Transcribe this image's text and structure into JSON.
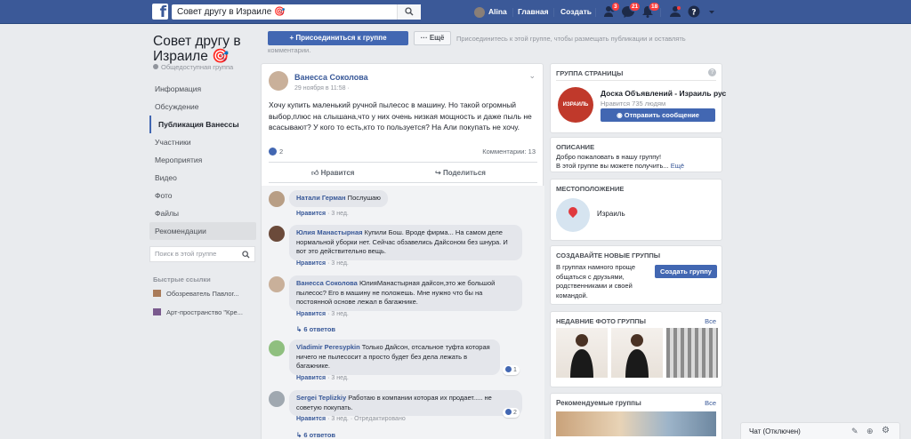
{
  "topbar": {
    "logo": "f",
    "search_value": "Совет другу в Израиле 🎯",
    "user_name": "Alina",
    "home": "Главная",
    "create": "Создать",
    "badges": {
      "friends": "3",
      "messages": "21",
      "notifications": "18"
    }
  },
  "group": {
    "title": "Совет другу в Израиле 🎯",
    "privacy": "Общедоступная группа",
    "nav": [
      {
        "label": "Информация"
      },
      {
        "label": "Обсуждение"
      },
      {
        "label": "Публикация Ванессы"
      },
      {
        "label": "Участники"
      },
      {
        "label": "Мероприятия"
      },
      {
        "label": "Видео"
      },
      {
        "label": "Фото"
      },
      {
        "label": "Файлы"
      },
      {
        "label": "Рекомендации"
      }
    ],
    "search_placeholder": "Поиск в этой группе",
    "quick_links_title": "Быстрые ссылки",
    "quick_links": [
      "Обозреватель Павлог...",
      "Арт-пространство \"Кре..."
    ]
  },
  "join": {
    "join_label": "Присоединиться к группе",
    "more_label": "Ещё",
    "note_line1": "Присоединитесь к этой группе, чтобы размещать публикации и оставлять",
    "note_line2": "комментарии."
  },
  "post": {
    "author": "Ванесса Соколова",
    "date": "29 ноября в 11:58",
    "text": "Хочу купить маленький ручной пылесос в машину. Но такой огромный выбор,плюс на слышана,что у них очень низкая мощность и даже пыль не всасывают? У кого то есть,кто то пользуется? На Али покупать не хочу.",
    "likes": "2",
    "comments_count": "Комментарии: 13",
    "like_action": "Нравится",
    "share_action": "Поделиться"
  },
  "comments": [
    {
      "author": "Натали Герман",
      "text": "Послушаю",
      "like": "Нравится",
      "time": "3 нед."
    },
    {
      "author": "Юлия Манастырная",
      "text": "Купили Бош. Вроде фирма... На самом деле нормальной уборки нет. Сейчас обзавелись Дайсоном без шнура. И вот это действительно вещь.",
      "like": "Нравится",
      "time": "3 нед."
    },
    {
      "author": "Ванесса Соколова",
      "text": "ЮлияМанастырная дайсон,это же большой пылесос? Его в машину не положешь. Мне нужно что бы на постоянной основе лежал в багажнике.",
      "like": "Нравится",
      "time": "3 нед.",
      "replies": "6 ответов"
    },
    {
      "author": "Vladimir Peresypkin",
      "text": "Только Дайсон, отсальное туфта которая ничего не пылесосит а просто будет без дела лежать в багажнике.",
      "like": "Нравится",
      "time": "3 нед.",
      "reactions": "1"
    },
    {
      "author": "Sergei Teplizkiy",
      "text": "Работаю в компании которая их продает..... не советую покупать.",
      "like": "Нравится",
      "time": "3 нед.",
      "edited": "Отредактировано",
      "reactions": "2",
      "replies": "6 ответов"
    }
  ],
  "right": {
    "page_card": {
      "title": "ГРУППА СТРАНИЦЫ",
      "page_name": "Доска Объявлений - Израиль рус",
      "likes": "Нравится 735 людям",
      "message_btn": "Отправить сообщение",
      "logo_text": "ИЗРАИЛЬ"
    },
    "description": {
      "title": "ОПИСАНИЕ",
      "line1": "Добро пожаловать в нашу группу!",
      "line2": "В этой группе вы можете получить...",
      "more": "Ещё"
    },
    "location": {
      "title": "МЕСТОПОЛОЖЕНИЕ",
      "name": "Израиль"
    },
    "create_groups": {
      "title": "СОЗДАВАЙТЕ НОВЫЕ ГРУППЫ",
      "text_lines": [
        "В группах намного проще",
        "общаться с друзьями,",
        "родственниками и своей",
        "командой."
      ],
      "button": "Создать группу"
    },
    "photos": {
      "title": "НЕДАВНИЕ ФОТО ГРУППЫ",
      "see_all": "Все"
    },
    "recommended": {
      "title": "Рекомендуемые группы",
      "see_all": "Все"
    }
  },
  "chat": {
    "label": "Чат (Отключен)"
  },
  "colors": {
    "brand": "#3b5998",
    "accent": "#4267b2",
    "badge": "#fa3e3e"
  }
}
